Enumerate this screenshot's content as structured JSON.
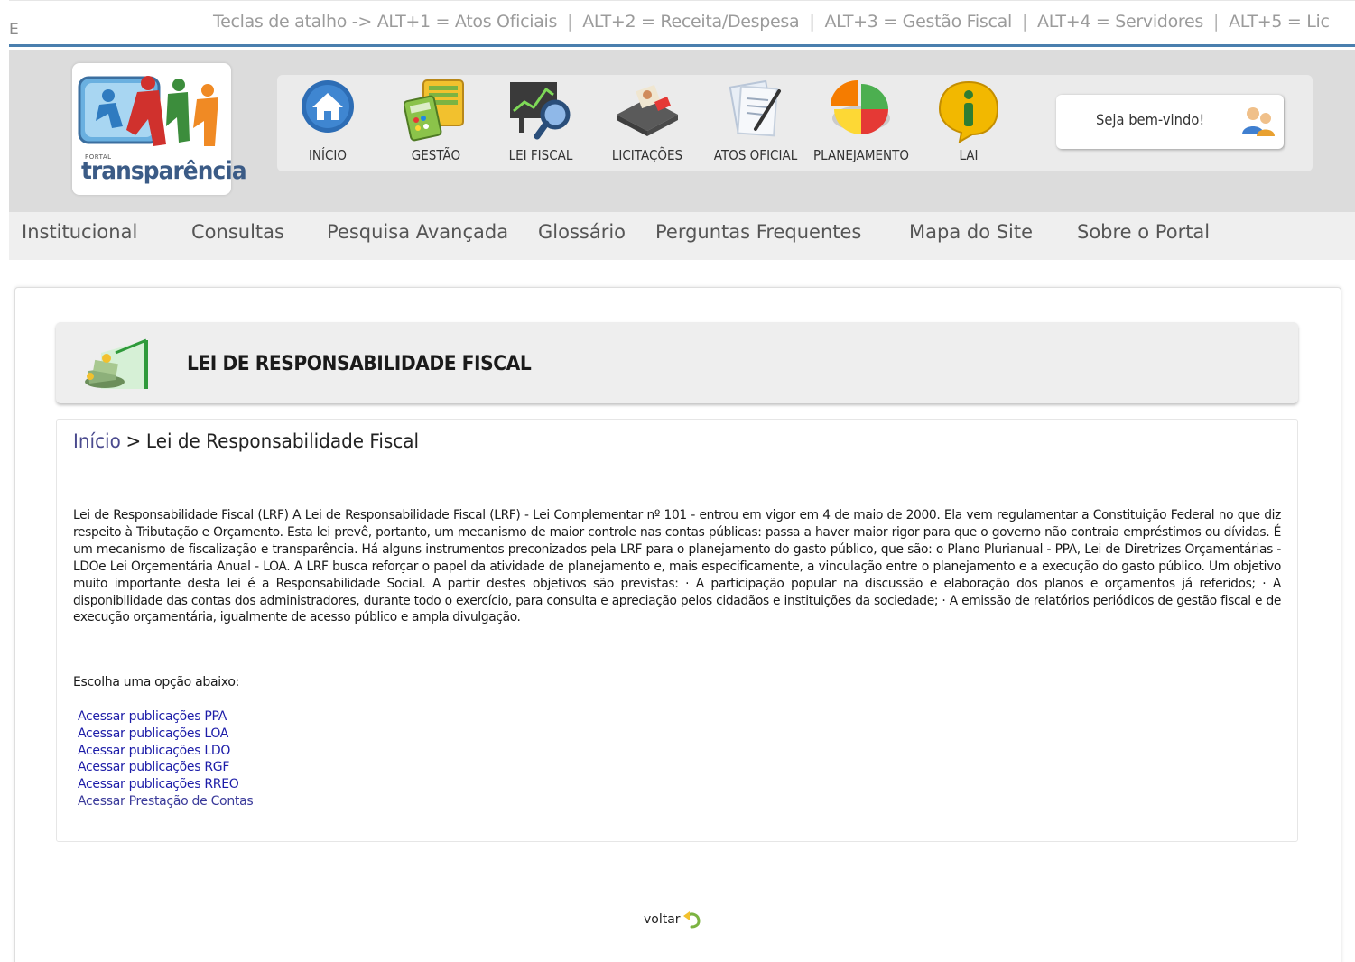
{
  "shortcuts": {
    "letter": "E",
    "prefix": "Teclas de atalho -> ALT+1 = Atos Oficiais",
    "item2": "ALT+2 = Receita/Despesa",
    "item3": "ALT+3 = Gestão Fiscal",
    "item4": "ALT+4 = Servidores",
    "item5": "ALT+5 = Lic"
  },
  "logo": {
    "small": "PORTAL",
    "big": "transparência"
  },
  "nav": {
    "items": [
      {
        "label": "INÍCIO",
        "icon": "home-icon"
      },
      {
        "label": "GESTÃO",
        "icon": "calculator-icon"
      },
      {
        "label": "LEI FISCAL",
        "icon": "chart-magnifier-icon"
      },
      {
        "label": "LICITAÇÕES",
        "icon": "briefcase-icon"
      },
      {
        "label": "ATOS OFICIAL",
        "icon": "document-pen-icon"
      },
      {
        "label": "PLANEJAMENTO",
        "icon": "pie-chart-icon"
      },
      {
        "label": "LAI",
        "icon": "info-icon"
      }
    ]
  },
  "welcome": {
    "text": "Seja bem-vindo!",
    "icon": "users-icon"
  },
  "menu": {
    "items": [
      "Institucional",
      "Consultas",
      "Pesquisa Avançada",
      "Glossário",
      "Perguntas Frequentes",
      "Mapa do Site",
      "Sobre o Portal"
    ]
  },
  "title": {
    "text": "LEI DE RESPONSABILIDADE FISCAL",
    "icon": "money-chart-icon"
  },
  "breadcrumb": {
    "home": "Início",
    "separator": ">",
    "current": "Lei de Responsabilidade Fiscal"
  },
  "body": {
    "text": "Lei de Responsabilidade Fiscal (LRF) A Lei de Responsabilidade Fiscal (LRF) - Lei Complementar nº 101 - entrou em vigor em 4 de maio de 2000. Ela vem regulamentar a Constituição Federal no que diz respeito à Tributação e Orçamento. Esta lei prevê, portanto, um mecanismo de maior controle nas contas públicas: passa a haver maior rigor para que o governo não contraia empréstimos ou dívidas. É um mecanismo de fiscalização e transparência. Há alguns instrumentos preconizados pela LRF para o planejamento do gasto público, que são: o Plano Plurianual - PPA, Lei de Diretrizes Orçamentárias - LDOe Lei Orçementária Anual - LOA. A LRF busca reforçar o papel da atividade de planejamento e, mais especificamente, a vinculação entre o planejamento e a execução do gasto público. Um objetivo muito importante desta lei é a Responsabilidade Social. A partir destes objetivos são previstas: · A participação popular na discussão e elaboração dos planos e orçamentos já referidos; · A disponibilidade das contas dos administradores, durante todo o exercício, para consulta e apreciação pelos cidadãos e instituições da sociedade; · A emissão de relatórios periódicos de gestão fiscal e de execução orçamentária, igualmente de acesso público e ampla divulgação.",
    "choose": "Escolha uma opção abaixo:"
  },
  "links": [
    "Acessar publicações PPA",
    "Acessar publicações LOA",
    "Acessar publicações LDO",
    "Acessar publicações RGF",
    "Acessar publicações RREO",
    "Acessar Prestação de Contas"
  ],
  "footer": {
    "back": "voltar",
    "back_icon": "back-arrow-icon"
  }
}
